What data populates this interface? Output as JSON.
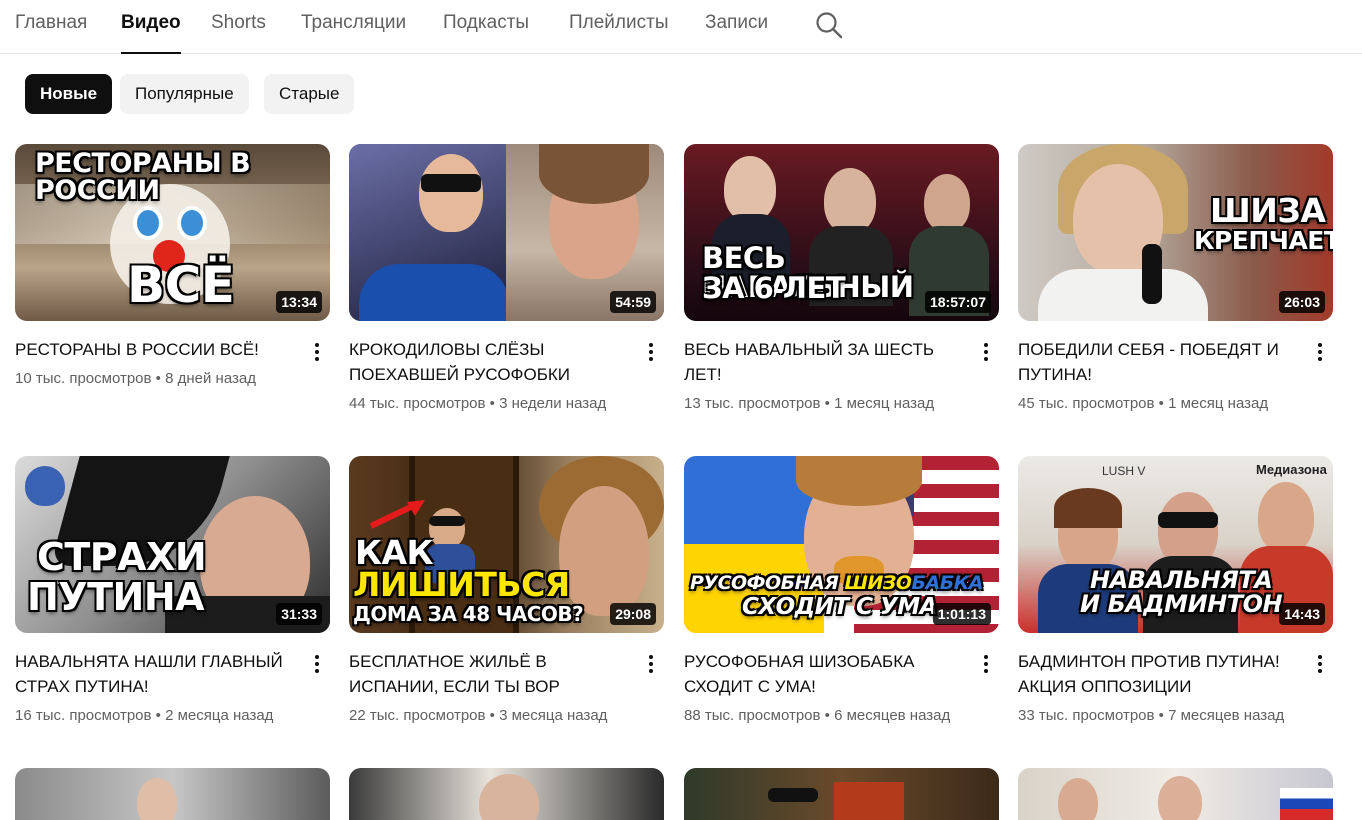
{
  "tabs": [
    {
      "label": "Главная"
    },
    {
      "label": "Видео"
    },
    {
      "label": "Shorts"
    },
    {
      "label": "Трансляции"
    },
    {
      "label": "Подкасты"
    },
    {
      "label": "Плейлисты"
    },
    {
      "label": "Записи"
    }
  ],
  "active_tab": "Видео",
  "search_icon": "search-icon",
  "chips": [
    {
      "label": "Новые",
      "active": true
    },
    {
      "label": "Популярные",
      "active": false
    },
    {
      "label": "Старые",
      "active": false
    }
  ],
  "videos": [
    {
      "title": "РЕСТОРАНЫ В РОССИИ ВСЁ!",
      "views": "10 тыс. просмотров",
      "age": "8 дней назад",
      "duration": "13:34",
      "thumb_text": [
        "РЕСТОРАНЫ В РОССИИ",
        "ВСЁ"
      ]
    },
    {
      "title": "КРОКОДИЛОВЫ СЛЁЗЫ ПОЕХАВШЕЙ РУСОФОБКИ",
      "views": "44 тыс. просмотров",
      "age": "3 недели назад",
      "duration": "54:59",
      "thumb_text": []
    },
    {
      "title": "ВЕСЬ НАВАЛЬНЫЙ ЗА ШЕСТЬ ЛЕТ!",
      "views": "13 тыс. просмотров",
      "age": "1 месяц назад",
      "duration": "18:57:07",
      "thumb_text": [
        "ВЕСЬ НАВАЛЬНЫЙ",
        "ЗА 6 ЛЕТ"
      ]
    },
    {
      "title": "ПОБЕДИЛИ СЕБЯ - ПОБЕДЯТ И ПУТИНА!",
      "views": "45 тыс. просмотров",
      "age": "1 месяц назад",
      "duration": "26:03",
      "thumb_text": [
        "ШИЗА",
        "КРЕПЧАЕТ"
      ]
    },
    {
      "title": "НАВАЛЬНЯТА НАШЛИ ГЛАВНЫЙ СТРАХ ПУТИНА!",
      "views": "16 тыс. просмотров",
      "age": "2 месяца назад",
      "duration": "31:33",
      "thumb_text": [
        "СТРАХИ",
        "ПУТИНА"
      ]
    },
    {
      "title": "БЕСПЛАТНОЕ ЖИЛЬЁ В ИСПАНИИ, ЕСЛИ ТЫ ВОР",
      "views": "22 тыс. просмотров",
      "age": "3 месяца назад",
      "duration": "29:08",
      "thumb_text": [
        "КАК",
        "ЛИШИТЬСЯ",
        "ДОМА ЗА 48 ЧАСОВ?"
      ]
    },
    {
      "title": "РУСОФОБНАЯ ШИЗОБАБКА СХОДИТ С УМА!",
      "views": "88 тыс. просмотров",
      "age": "6 месяцев назад",
      "duration": "1:01:13",
      "thumb_text": [
        "РУСОФОБНАЯ ",
        "ШИЗО",
        "БАБКА",
        "СХОДИТ С УМА"
      ]
    },
    {
      "title": "БАДМИНТОН ПРОТИВ ПУТИНА! АКЦИЯ ОППОЗИЦИИ",
      "views": "33 тыс. просмотров",
      "age": "7 месяцев назад",
      "duration": "14:43",
      "thumb_text": [
        "НАВАЛЬНЯТА",
        "И БАДМИНТОН",
        "LUSH V",
        "Медиазона"
      ]
    }
  ],
  "separator": "•",
  "colors": {
    "text": "#0f0f0f",
    "secondary": "#606060",
    "chip_bg": "#f2f2f2",
    "chip_active_bg": "#0f0f0f",
    "thumb_yellow": "#ffe600"
  }
}
